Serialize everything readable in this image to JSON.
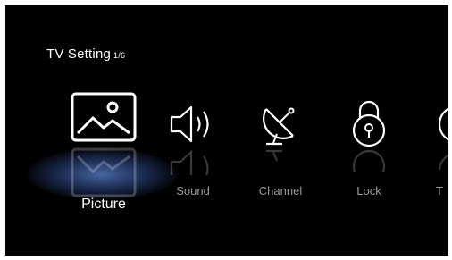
{
  "header": {
    "title": "TV Setting",
    "page_indicator": "1/6"
  },
  "menu": {
    "selected_index": 0,
    "items": [
      {
        "label": "Picture",
        "icon": "picture-icon"
      },
      {
        "label": "Sound",
        "icon": "speaker-icon"
      },
      {
        "label": "Channel",
        "icon": "satellite-dish-icon"
      },
      {
        "label": "Lock",
        "icon": "lock-icon"
      },
      {
        "label": "T",
        "icon": "clock-icon"
      }
    ]
  },
  "colors": {
    "background": "#000000",
    "text_selected": "#ffffff",
    "text_unselected": "#9a9a9a",
    "highlight_glow": "#5f87d7"
  }
}
